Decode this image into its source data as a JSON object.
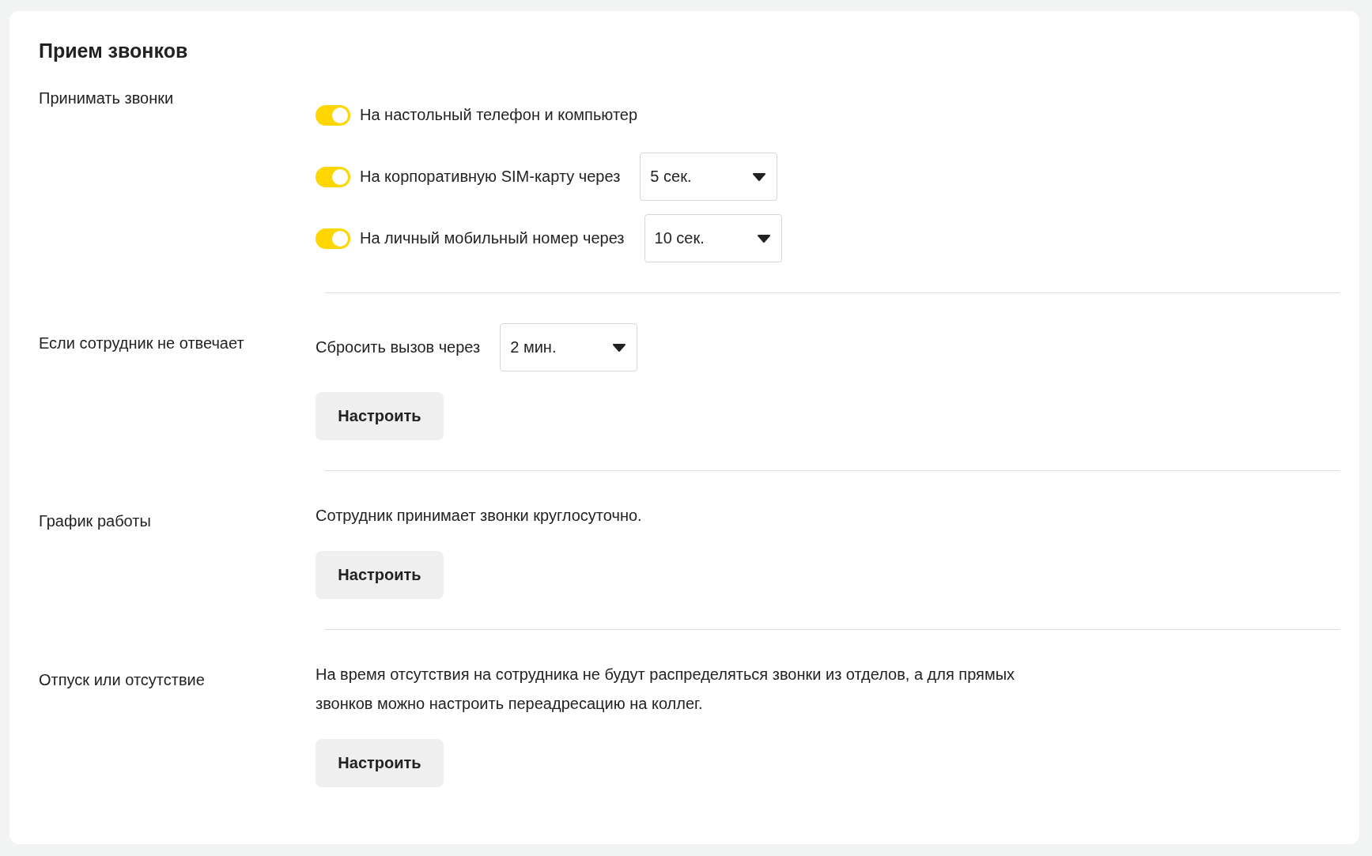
{
  "title": "Прием звонков",
  "sections": [
    {
      "label": "Принимать звонки",
      "kind": "toggles",
      "toggles": [
        {
          "label": "На настольный телефон и компьютер",
          "on": true
        },
        {
          "label": "На корпоративную SIM-карту через",
          "on": true,
          "select": "5 сек."
        },
        {
          "label": "На личный мобильный номер через",
          "on": true,
          "select": "10 сек."
        }
      ]
    },
    {
      "label": "Если сотрудник не отвечает",
      "kind": "select",
      "text": "Сбросить вызов через",
      "select": "2 мин.",
      "button": "Настроить"
    },
    {
      "label": "График работы",
      "kind": "text",
      "text": "Сотрудник принимает звонки круглосуточно.",
      "button": "Настроить"
    },
    {
      "label": "Отпуск или отсутствие",
      "kind": "text",
      "text": "На время отсутствия на сотрудника не будут распределяться звонки из отделов, а для прямых звонков можно настроить переадресацию на коллег.",
      "button": "Настроить"
    }
  ]
}
